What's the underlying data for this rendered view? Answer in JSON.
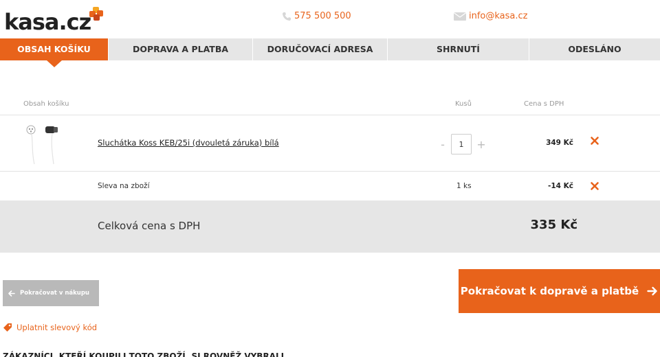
{
  "header": {
    "logo": "kasa.cz",
    "phone": "575 500 500",
    "email": "info@kasa.cz"
  },
  "steps": [
    {
      "label": "OBSAH KOŠÍKU",
      "active": true
    },
    {
      "label": "DOPRAVA A PLATBA",
      "active": false
    },
    {
      "label": "DORUČOVACÍ ADRESA",
      "active": false
    },
    {
      "label": "SHRNUTÍ",
      "active": false
    },
    {
      "label": "ODESLÁNO",
      "active": false
    }
  ],
  "cart": {
    "columns": {
      "content": "Obsah košíku",
      "qty": "Kusů",
      "price": "Cena s DPH"
    },
    "item": {
      "name": "Sluchátka Koss KEB/25i (dvouletá záruka) bílá",
      "qty_minus": "-",
      "qty": "1",
      "qty_plus": "+",
      "price": "349 Kč"
    },
    "discount": {
      "name": "Sleva na zboží",
      "qty": "1 ks",
      "price": "-14 Kč"
    },
    "total": {
      "label": "Celková cena s DPH",
      "value": "335 Kč"
    }
  },
  "actions": {
    "back": "Pokračovat v nákupu",
    "next": "Pokračovat k dopravě a platbě",
    "coupon": "Uplatnit slevový kód"
  },
  "recommend": {
    "title": "ZÁKAZNÍCI, KTEŘÍ KOUPILI TOTO ZBOŽÍ, SI ROVNĚŽ VYBRALI"
  },
  "colors": {
    "accent": "#e8631b",
    "tab_bg": "#e6e6e6",
    "back_btn": "#b9b9b9",
    "remove": "#e8631b"
  }
}
